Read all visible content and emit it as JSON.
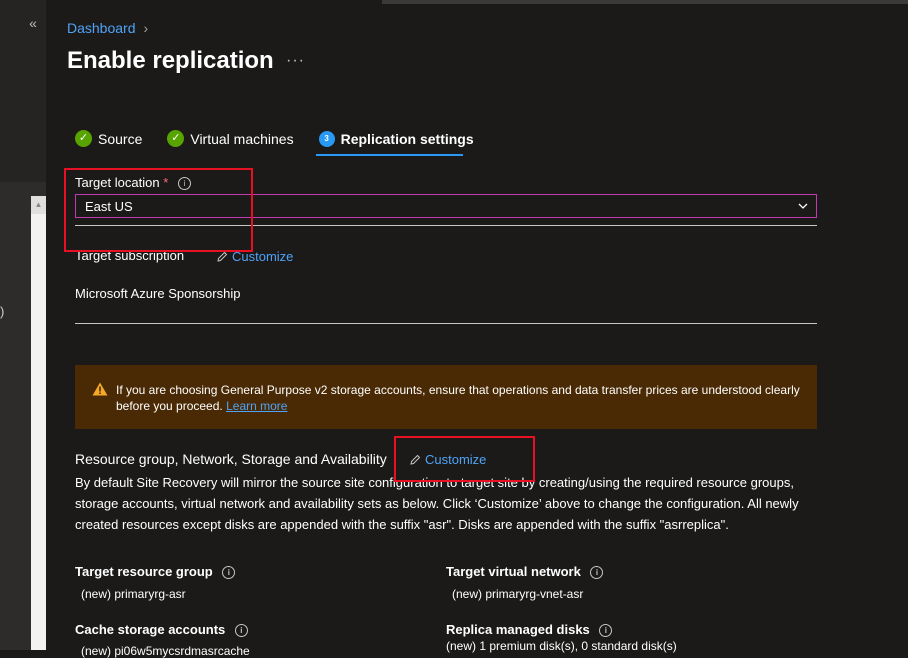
{
  "breadcrumb": {
    "root": "Dashboard"
  },
  "page": {
    "title": "Enable replication",
    "more": "···"
  },
  "steps": [
    {
      "label": "Source",
      "state": "done"
    },
    {
      "label": "Virtual machines",
      "state": "done"
    },
    {
      "label": "Replication settings",
      "state": "active",
      "number": "3"
    }
  ],
  "target_location": {
    "label": "Target location",
    "required_mark": "*",
    "value": "East US"
  },
  "target_subscription": {
    "label": "Target subscription",
    "customize": "Customize",
    "value": "Microsoft Azure Sponsorship"
  },
  "warning": {
    "text": "If you are choosing General Purpose v2 storage accounts, ensure that operations and data transfer prices are understood clearly before you proceed.",
    "link": "Learn more"
  },
  "resource_section": {
    "label": "Resource group, Network, Storage and Availability",
    "customize": "Customize",
    "description": "By default Site Recovery will mirror the source site configuration to target site by creating/using the required resource groups, storage accounts, virtual network and availability sets as below. Click ‘Customize’ above to change the configuration. All newly created resources except disks are appended with the suffix \"asr\". Disks are appended with the suffix \"asrreplica\"."
  },
  "fields": {
    "target_resource_group": {
      "label": "Target resource group",
      "value": "(new) primaryrg-asr"
    },
    "target_virtual_network": {
      "label": "Target virtual network",
      "value": "(new) primaryrg-vnet-asr"
    },
    "cache_storage_accounts": {
      "label": "Cache storage accounts",
      "value": "(new) pi06w5mycsrdmasrcache"
    },
    "replica_managed_disks": {
      "label": "Replica managed disks",
      "value": "(new) 1 premium disk(s), 0 standard disk(s)"
    }
  },
  "left_pane": {
    "collapse": "«",
    "edge_char": ")",
    "scroll_up": "▲"
  },
  "colors": {
    "accent": "#2899f5",
    "link": "#4fa3f7",
    "success": "#57a300",
    "highlight": "#e81123",
    "warning_bg": "#4a2a05"
  }
}
